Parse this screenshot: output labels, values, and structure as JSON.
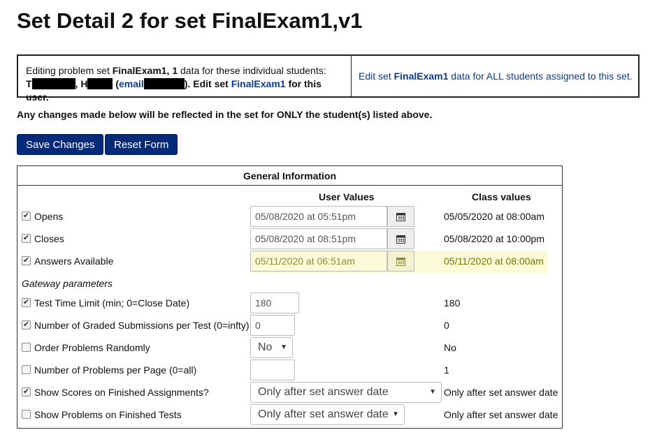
{
  "page": {
    "title": "Set Detail 2 for set FinalExam1,v1"
  },
  "info": {
    "editing_prefix": "Editing problem set ",
    "set_version_bold": "FinalExam1, 1",
    "editing_suffix": " data for these individual students:",
    "student_initial_1": "T",
    "student_sep": ", H",
    "email_open": " (",
    "email_link": "email",
    "edit_for_user_prefix": "). Edit set ",
    "set_link": "FinalExam1",
    "edit_for_user_suffix": " for this user.",
    "right_prefix": "Edit set ",
    "right_set_link": "FinalExam1",
    "right_suffix": " data for ALL students assigned to this set."
  },
  "notice": "Any changes made below will be reflected in the set for ONLY the student(s) listed above.",
  "buttons": {
    "save": "Save Changes",
    "reset": "Reset Form"
  },
  "panel": {
    "header": "General Information",
    "user_values_header": "User Values",
    "class_values_header": "Class values",
    "gateway_label": "Gateway parameters"
  },
  "rows": {
    "opens": {
      "label": "Opens",
      "checked": true,
      "user_value": "05/08/2020 at 05:51pm",
      "class_value": "05/05/2020 at 08:00am"
    },
    "closes": {
      "label": "Closes",
      "checked": true,
      "user_value": "05/08/2020 at 08:51pm",
      "class_value": "05/08/2020 at 10:00pm"
    },
    "answers": {
      "label": "Answers Available",
      "checked": true,
      "user_value": "05/11/2020 at 06:51am",
      "class_value": "05/11/2020 at 08:00am"
    },
    "time_limit": {
      "label": "Test Time Limit (min; 0=Close Date)",
      "checked": true,
      "user_value": "180",
      "class_value": "180"
    },
    "graded_subs": {
      "label": "Number of Graded Submissions per Test (0=infty)",
      "checked": true,
      "user_value": "0",
      "class_value": "0"
    },
    "order_random": {
      "label": "Order Problems Randomly",
      "checked": false,
      "user_value": "No",
      "class_value": "No"
    },
    "per_page": {
      "label": "Number of Problems per Page (0=all)",
      "checked": false,
      "user_value": "",
      "class_value": "1"
    },
    "show_scores": {
      "label": "Show Scores on Finished Assignments?",
      "checked": true,
      "user_value": "Only after set answer date",
      "class_value": "Only after set answer date"
    },
    "show_problems": {
      "label": "Show Problems on Finished Tests",
      "checked": false,
      "user_value": "Only after set answer date",
      "class_value": "Only after set answer date"
    }
  },
  "colors": {
    "button_bg": "#052a78",
    "link": "#0b3b8c",
    "highlight": "#fbfbd7"
  }
}
